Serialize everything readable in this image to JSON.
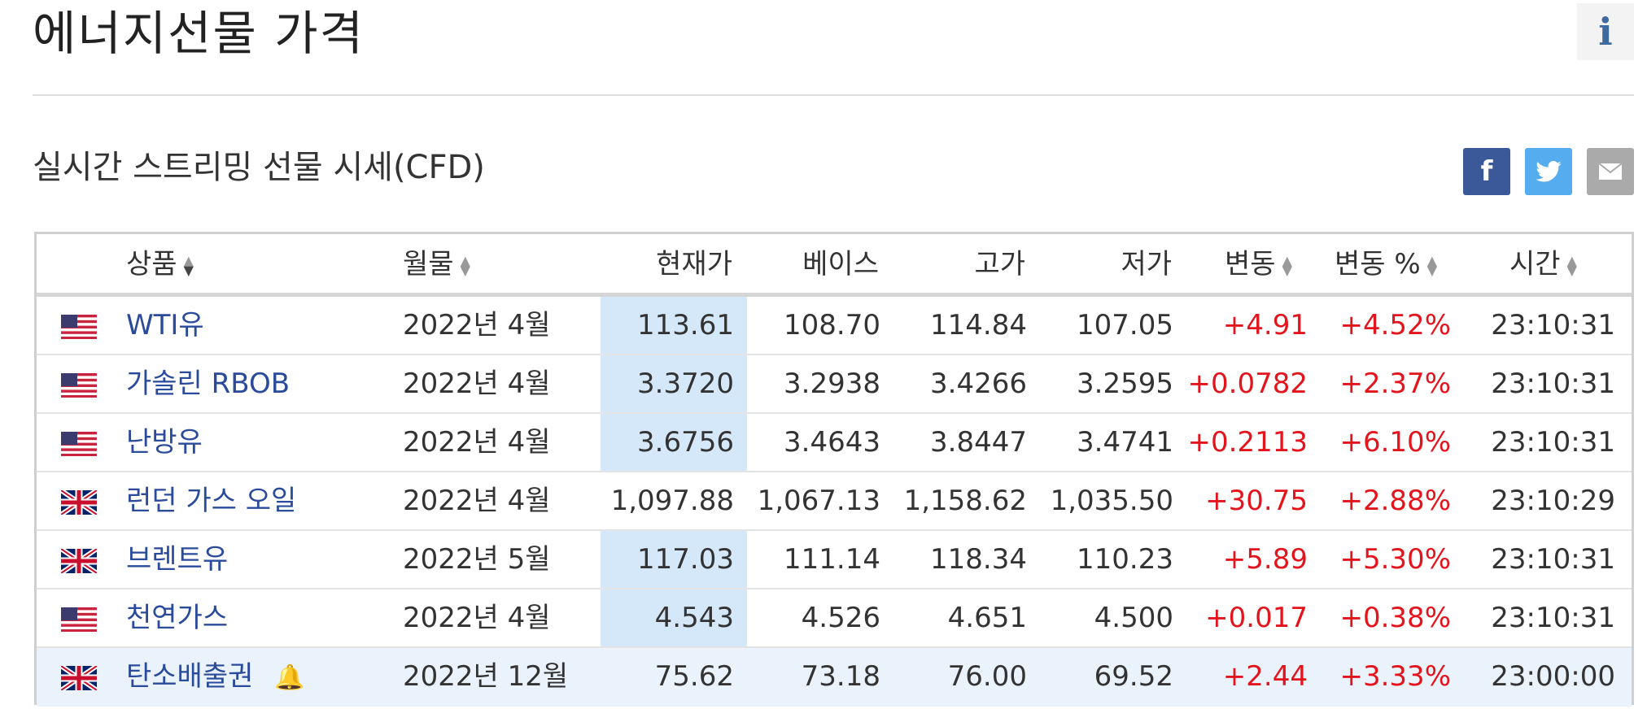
{
  "header": {
    "title": "에너지선물 가격",
    "info_label": "i"
  },
  "section": {
    "title": "실시간 스트리밍 선물 시세(CFD)"
  },
  "share": {
    "facebook": "f",
    "twitter": "t",
    "email": "✉"
  },
  "table": {
    "columns": [
      "상품",
      "월물",
      "현재가",
      "베이스",
      "고가",
      "저가",
      "변동",
      "변동 %",
      "시간"
    ],
    "rows": [
      {
        "flag": "us",
        "name": "WTI유",
        "month": "2022년 4월",
        "price": "113.61",
        "base": "108.70",
        "high": "114.84",
        "low": "107.05",
        "change": "+4.91",
        "pct": "+4.52%",
        "time": "23:10:31",
        "highlight": true
      },
      {
        "flag": "us",
        "name": "가솔린 RBOB",
        "month": "2022년 4월",
        "price": "3.3720",
        "base": "3.2938",
        "high": "3.4266",
        "low": "3.2595",
        "change": "+0.0782",
        "pct": "+2.37%",
        "time": "23:10:31",
        "highlight": true
      },
      {
        "flag": "us",
        "name": "난방유",
        "month": "2022년 4월",
        "price": "3.6756",
        "base": "3.4643",
        "high": "3.8447",
        "low": "3.4741",
        "change": "+0.2113",
        "pct": "+6.10%",
        "time": "23:10:31",
        "highlight": true
      },
      {
        "flag": "uk",
        "name": "런던 가스 오일",
        "month": "2022년 4월",
        "price": "1,097.88",
        "base": "1,067.13",
        "high": "1,158.62",
        "low": "1,035.50",
        "change": "+30.75",
        "pct": "+2.88%",
        "time": "23:10:29",
        "highlight": false
      },
      {
        "flag": "uk",
        "name": "브렌트유",
        "month": "2022년 5월",
        "price": "117.03",
        "base": "111.14",
        "high": "118.34",
        "low": "110.23",
        "change": "+5.89",
        "pct": "+5.30%",
        "time": "23:10:31",
        "highlight": true
      },
      {
        "flag": "us",
        "name": "천연가스",
        "month": "2022년 4월",
        "price": "4.543",
        "base": "4.526",
        "high": "4.651",
        "low": "4.500",
        "change": "+0.017",
        "pct": "+0.38%",
        "time": "23:10:31",
        "highlight": true
      },
      {
        "flag": "uk",
        "name": "탄소배출권",
        "month": "2022년 12월",
        "price": "75.62",
        "base": "73.18",
        "high": "76.00",
        "low": "69.52",
        "change": "+2.44",
        "pct": "+3.33%",
        "time": "23:00:00",
        "highlight": false,
        "alert": true
      }
    ]
  },
  "colors": {
    "up": "#e4141c",
    "link": "#2a4b9b",
    "highlight": "#d5e8fa",
    "last_row": "#eaf2fb"
  }
}
